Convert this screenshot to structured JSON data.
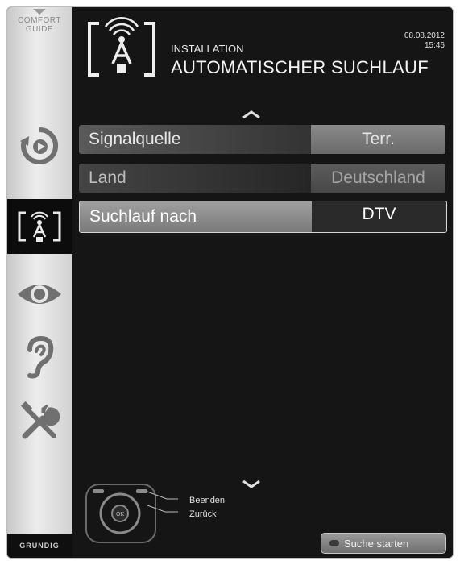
{
  "sidebar": {
    "comfort_guide_line1": "COMFORT",
    "comfort_guide_line2": "GUIDE",
    "brand": "GRUNDIG",
    "items": [
      {
        "icon": "source-icon"
      },
      {
        "icon": "installation-antenna-icon",
        "active": true
      },
      {
        "icon": "eye-icon"
      },
      {
        "icon": "ear-icon"
      },
      {
        "icon": "tools-icon"
      }
    ]
  },
  "header": {
    "section": "INSTALLATION",
    "title": "AUTOMATISCHER SUCHLAUF",
    "date": "08.08.2012",
    "time": "15:46"
  },
  "menu": {
    "rows": [
      {
        "label": "Signalquelle",
        "value": "Terr."
      },
      {
        "label": "Land",
        "value": "Deutschland"
      },
      {
        "label": "Suchlauf nach",
        "value": "DTV"
      }
    ]
  },
  "footer": {
    "hint_exit": "Beenden",
    "hint_back": "Zurück",
    "start_button": "Suche starten",
    "ok_label": "OK"
  },
  "colors": {
    "background": "#151515",
    "sidebar": "#e0e0e0",
    "selected_row": "#8c8c8c"
  }
}
